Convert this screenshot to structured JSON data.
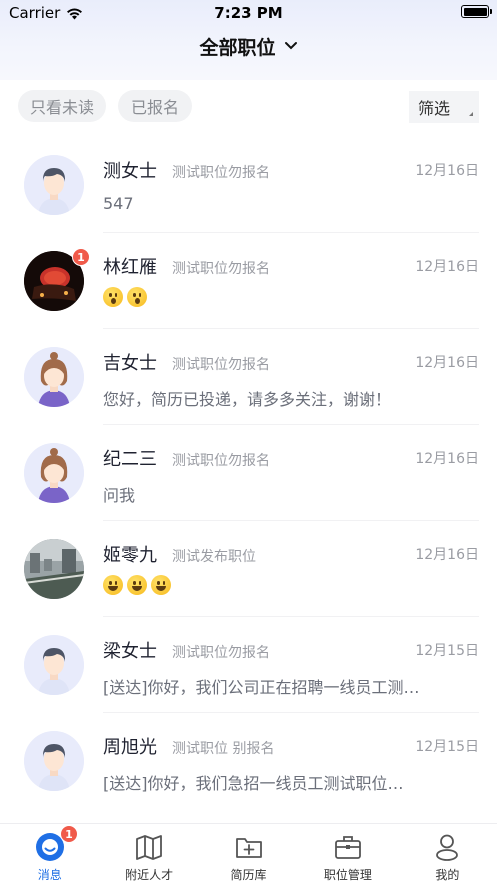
{
  "status_bar": {
    "carrier": "Carrier",
    "time": "7:23 PM"
  },
  "nav": {
    "title": "全部职位"
  },
  "filters": {
    "unread": "只看未读",
    "applied": "已报名",
    "filter": "筛选"
  },
  "messages": [
    {
      "name": "测女士",
      "job": "测试职位勿报名",
      "date": "12月16日",
      "preview": "547",
      "avatar": "avatar-male-icon"
    },
    {
      "name": "林红雁",
      "job": "测试职位勿报名",
      "date": "12月16日",
      "emoji": [
        "😮",
        "😮"
      ],
      "badge": "1",
      "avatar": "photo-avatar"
    },
    {
      "name": "吉女士",
      "job": "测试职位勿报名",
      "date": "12月16日",
      "preview": "您好，简历已投递，请多多关注，谢谢！",
      "avatar": "avatar-female-icon"
    },
    {
      "name": "纪二三",
      "job": "测试职位勿报名",
      "date": "12月16日",
      "preview": "问我",
      "avatar": "avatar-female-icon"
    },
    {
      "name": "姬零九",
      "job": "测试发布职位",
      "date": "12月16日",
      "emoji": [
        "😃",
        "😃",
        "😃"
      ],
      "avatar": "photo-avatar"
    },
    {
      "name": "梁女士",
      "job": "测试职位勿报名",
      "date": "12月15日",
      "preview": "[送达]你好，我们公司正在招聘一线员工测…",
      "avatar": "avatar-male-icon"
    },
    {
      "name": "周旭光",
      "job": "测试职位 别报名",
      "date": "12月15日",
      "preview": "[送达]你好，我们急招一线员工测试职位…",
      "avatar": "avatar-male-icon"
    }
  ],
  "tabbar": {
    "items": [
      {
        "label": "消息",
        "icon": "message-icon",
        "badge": "1"
      },
      {
        "label": "附近人才",
        "icon": "map-icon"
      },
      {
        "label": "简历库",
        "icon": "folder-add-icon"
      },
      {
        "label": "职位管理",
        "icon": "briefcase-icon"
      },
      {
        "label": "我的",
        "icon": "user-icon"
      }
    ]
  },
  "colors": {
    "accent": "#1f6fe5",
    "badge": "#f05a4a",
    "avatar_bg": "#e8ebfb"
  }
}
